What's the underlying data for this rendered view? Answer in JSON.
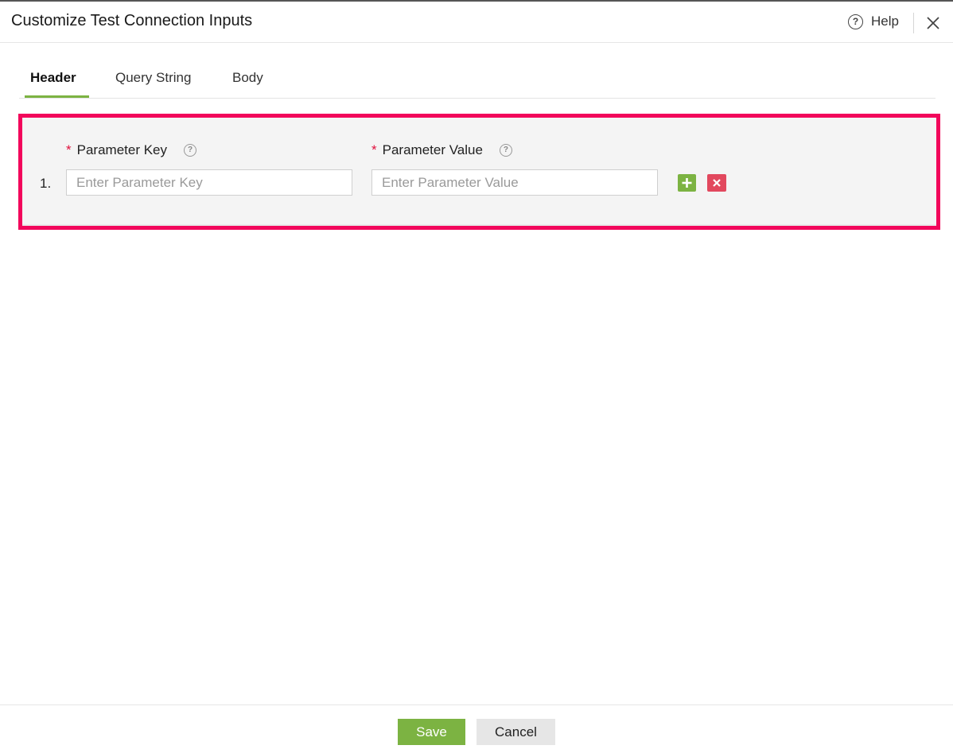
{
  "dialog": {
    "title": "Customize Test Connection Inputs",
    "help_label": "Help",
    "help_icon_glyph": "?",
    "icons": {
      "help": "help-circle-icon",
      "close": "close-icon"
    }
  },
  "tabs": [
    {
      "label": "Header",
      "active": true
    },
    {
      "label": "Query String",
      "active": false
    },
    {
      "label": "Body",
      "active": false
    }
  ],
  "params": {
    "key_label": "Parameter Key",
    "value_label": "Parameter Value",
    "required_marker": "*",
    "info_glyph": "?",
    "rows": [
      {
        "number": "1.",
        "key_value": "",
        "key_placeholder": "Enter Parameter Key",
        "value_value": "",
        "value_placeholder": "Enter Parameter Value"
      }
    ],
    "icons": {
      "add": "plus-icon",
      "remove": "x-icon"
    }
  },
  "footer": {
    "save_label": "Save",
    "cancel_label": "Cancel"
  },
  "colors": {
    "accent_green": "#7cb342",
    "danger_red": "#e2485e",
    "highlight_pink": "#f2065b",
    "required_red": "#e0113d"
  }
}
